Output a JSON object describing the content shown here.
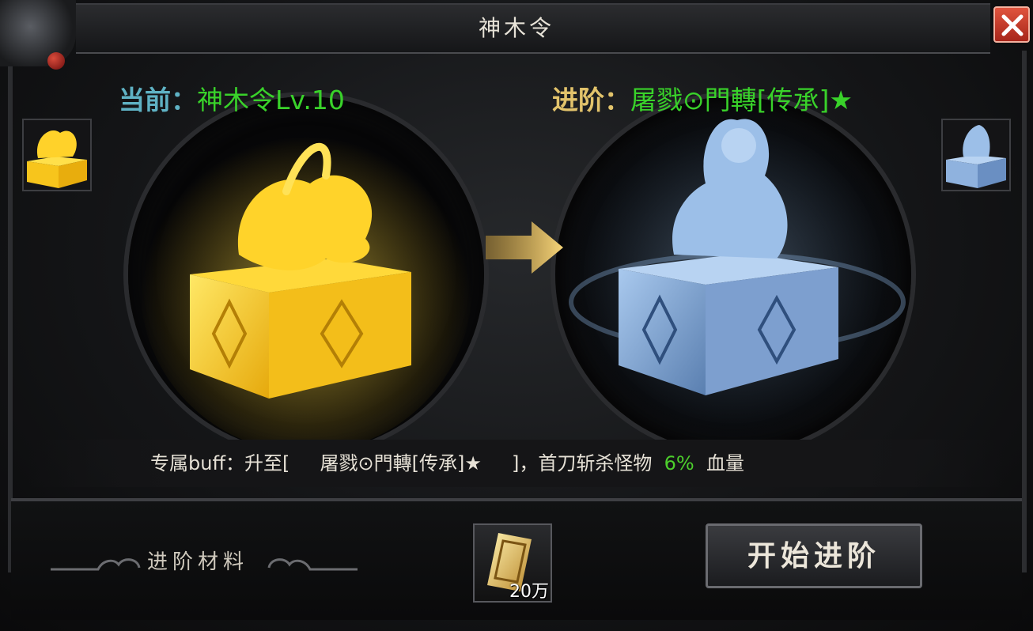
{
  "window": {
    "title": "神木令"
  },
  "current": {
    "prefix": "当前：",
    "name": "神木令Lv.10"
  },
  "advance": {
    "prefix": "进阶：",
    "name": "屠戮⊙門轉[传承]★"
  },
  "buff": {
    "prefix": "专属buff：升至[",
    "item": "屠戮⊙門轉[传承]★",
    "middle": "]，首刀斩杀怪物",
    "percent": "6%",
    "suffix": "血量"
  },
  "materials": {
    "label": "进阶材料",
    "count": "20万"
  },
  "actions": {
    "start_label": "开始进阶"
  },
  "colors": {
    "current_gold": "#f5c41a",
    "advance_ice": "#8fb8e6",
    "highlight_green": "#39d22a",
    "close_red": "#c83a2a"
  },
  "icons": [
    "close-icon",
    "arrow-right-icon",
    "gold-seal-icon",
    "ice-seal-icon",
    "material-ticket-icon",
    "cloud-ornament-icon",
    "dragon-ornament-icon"
  ]
}
